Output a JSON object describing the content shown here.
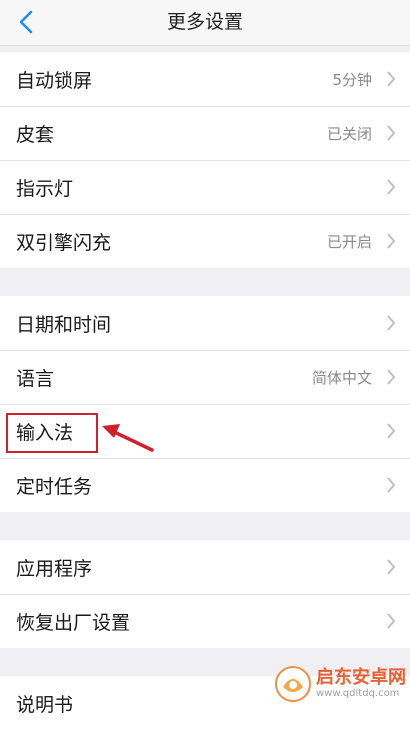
{
  "header": {
    "title": "更多设置"
  },
  "groups": [
    {
      "items": [
        {
          "label": "自动锁屏",
          "value": "5分钟"
        },
        {
          "label": "皮套",
          "value": "已关闭"
        },
        {
          "label": "指示灯",
          "value": ""
        },
        {
          "label": "双引擎闪充",
          "value": "已开启"
        }
      ]
    },
    {
      "items": [
        {
          "label": "日期和时间",
          "value": ""
        },
        {
          "label": "语言",
          "value": "简体中文"
        },
        {
          "label": "输入法",
          "value": ""
        },
        {
          "label": "定时任务",
          "value": ""
        }
      ]
    },
    {
      "items": [
        {
          "label": "应用程序",
          "value": ""
        },
        {
          "label": "恢复出厂设置",
          "value": ""
        }
      ]
    },
    {
      "items": [
        {
          "label": "说明书",
          "value": ""
        }
      ]
    }
  ],
  "annotation": {
    "highlighted_item": "输入法",
    "color": "#d0202a"
  },
  "watermark": {
    "name": "启东安卓网",
    "url": "www.qdltdq.com"
  },
  "colors": {
    "accent": "#1a8fe8",
    "background": "#efeff4"
  }
}
